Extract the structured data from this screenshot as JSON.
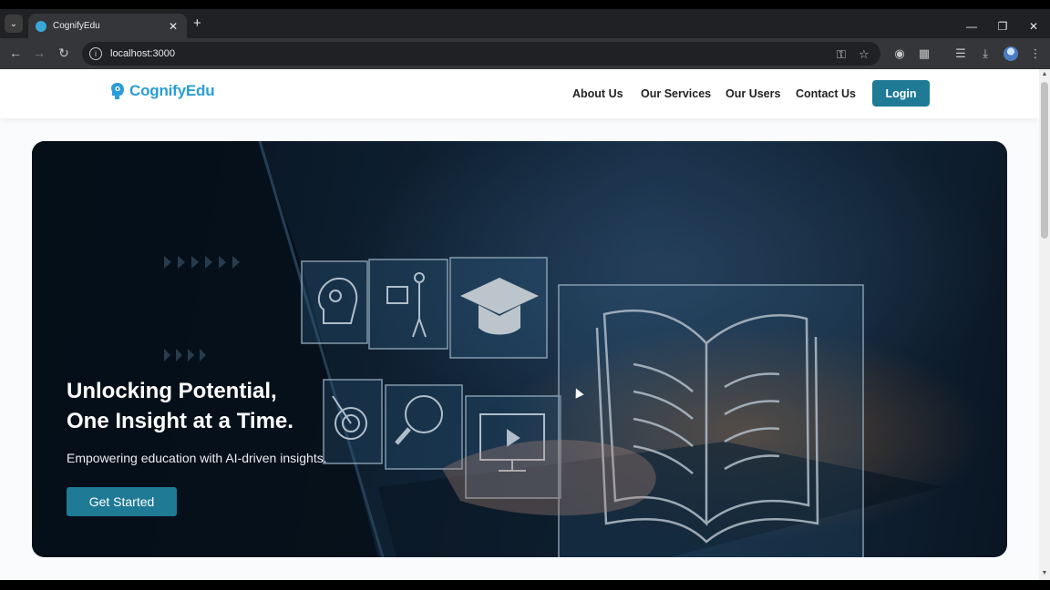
{
  "browser": {
    "tab_title": "CognifyEdu",
    "url": "localhost:3000"
  },
  "nav": {
    "brand": "CognifyEdu",
    "links": [
      "About Us",
      "Our Services",
      "Our Users",
      "Contact Us"
    ],
    "login_label": "Login"
  },
  "hero": {
    "title_line1": "Unlocking Potential,",
    "title_line2": "One Insight at a Time.",
    "subtitle": "Empowering education with AI-driven insights.",
    "cta_label": "Get Started"
  },
  "colors": {
    "brand_blue": "#2a9dd8",
    "button_teal": "#1f7a96"
  }
}
